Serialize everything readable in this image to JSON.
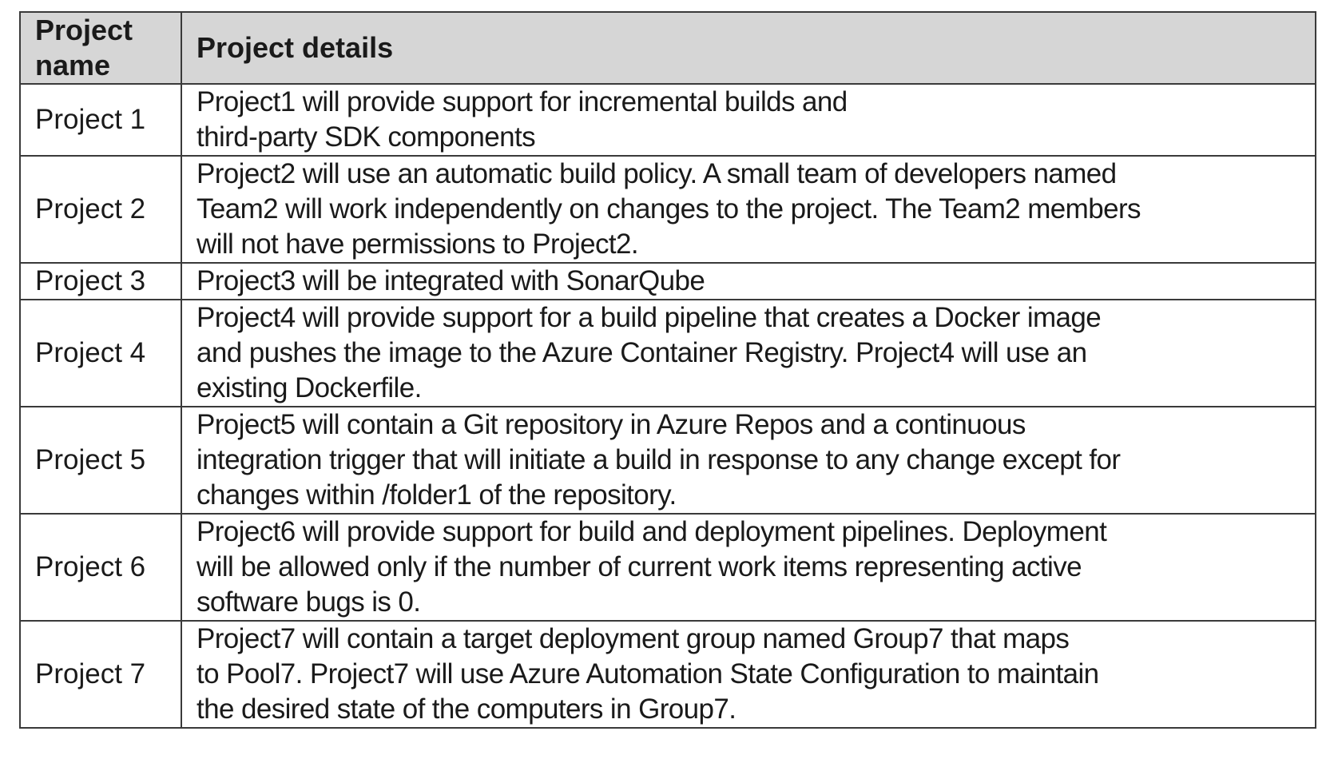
{
  "table": {
    "headers": {
      "name": "Project name",
      "details": "Project details"
    },
    "rows": [
      {
        "name": "Project 1",
        "details": [
          "Project1  will provide support for incremental builds and",
          "third-party  SDK components"
        ]
      },
      {
        "name": "Project 2",
        "details": [
          "Project2  will use an automatic build policy. A small team of developers named",
          "Team2  will work independently on changes to the project.  The Team2  members",
          "will not have permissions to Project2."
        ]
      },
      {
        "name": "Project 3",
        "details": [
          "Project3  will be integrated with SonarQube"
        ]
      },
      {
        "name": "Project 4",
        "details": [
          "Project4  will provide support for a build pipeline that creates a Docker image",
          "and pushes the image to the Azure Container Registry. Project4  will use an",
          "existing Dockerfile."
        ]
      },
      {
        "name": "Project 5",
        "details": [
          "Project5  will contain a Git repository  in Azure Repos  and a continuous",
          "integration trigger that will initiate a build in response to any change except for",
          "changes within /folder1 of the repository."
        ]
      },
      {
        "name": "Project 6",
        "details": [
          "Project6  will provide support for build and deployment pipelines. Deployment",
          "will be allowed only if the number of current work items representing active",
          "software bugs is 0."
        ]
      },
      {
        "name": "Project 7",
        "details": [
          "Project7  will contain a target  deployment group named Group7 that maps",
          "to  Pool7.  Project7  will use Azure Automation State Configuration to maintain",
          "the desired state  of the computers in Group7."
        ]
      }
    ]
  }
}
